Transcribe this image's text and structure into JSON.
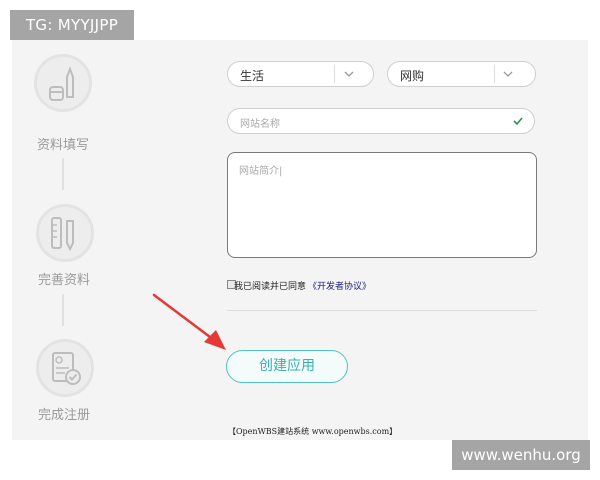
{
  "badge": {
    "text": "TG: MYYJJPP"
  },
  "watermark": {
    "text": "www.wenhu.org"
  },
  "steps": [
    {
      "label": "资料填写",
      "icon": "pen-icon"
    },
    {
      "label": "完善资料",
      "icon": "ruler-pen-icon"
    },
    {
      "label": "完成注册",
      "icon": "document-check-icon"
    }
  ],
  "form": {
    "category_select": {
      "value": "生活"
    },
    "subcategory_select": {
      "value": "网购"
    },
    "site_name": {
      "placeholder": "网站名称"
    },
    "site_intro": {
      "placeholder": "网站简介|"
    },
    "agreement": {
      "text": "我已阅读并已同意",
      "link": "《开发者协议》"
    },
    "submit_label": "创建应用"
  },
  "footer": {
    "text": "【OpenWBS建站系统 www.openwbs.com】"
  },
  "colors": {
    "accent": "#4fc4c0",
    "arrow": "#e53935",
    "valid": "#2e8b57"
  }
}
